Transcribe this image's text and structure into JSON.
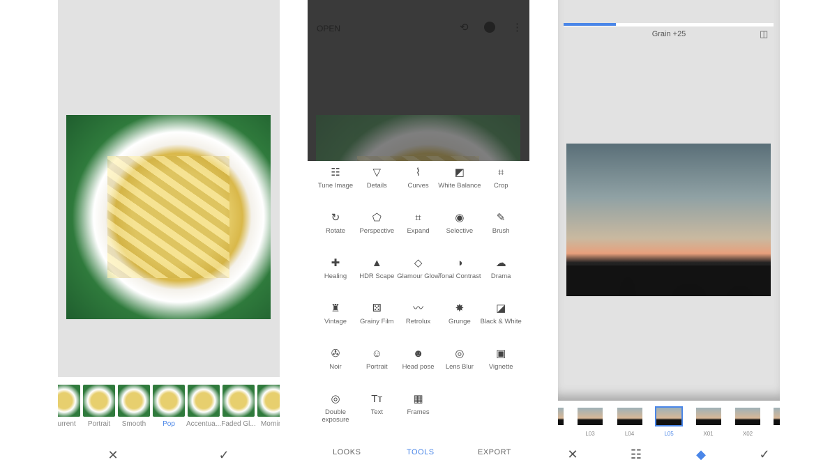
{
  "looks_panel": {
    "filters": [
      "Current",
      "Portrait",
      "Smooth",
      "Pop",
      "Accentua...",
      "Faded Gl...",
      "Morning"
    ],
    "selected": "Pop",
    "cancel_icon": "close-icon",
    "apply_icon": "check-icon"
  },
  "tools_panel": {
    "header": {
      "open_label": "OPEN",
      "icons": [
        "history-icon",
        "info-icon",
        "more-vert-icon"
      ]
    },
    "tools": [
      {
        "label": "Tune Image",
        "icon": "☷"
      },
      {
        "label": "Details",
        "icon": "▽"
      },
      {
        "label": "Curves",
        "icon": "⌇"
      },
      {
        "label": "White Balance",
        "icon": "◩"
      },
      {
        "label": "Crop",
        "icon": "⌗"
      },
      {
        "label": "Rotate",
        "icon": "↻"
      },
      {
        "label": "Perspective",
        "icon": "⬠"
      },
      {
        "label": "Expand",
        "icon": "⌗"
      },
      {
        "label": "Selective",
        "icon": "◉"
      },
      {
        "label": "Brush",
        "icon": "✎"
      },
      {
        "label": "Healing",
        "icon": "✚"
      },
      {
        "label": "HDR Scape",
        "icon": "▲"
      },
      {
        "label": "Glamour Glow",
        "icon": "◇"
      },
      {
        "label": "Tonal Contrast",
        "icon": "◑"
      },
      {
        "label": "Drama",
        "icon": "☁"
      },
      {
        "label": "Vintage",
        "icon": "♜"
      },
      {
        "label": "Grainy Film",
        "icon": "⚄"
      },
      {
        "label": "Retrolux",
        "icon": "〰"
      },
      {
        "label": "Grunge",
        "icon": "✸"
      },
      {
        "label": "Black & White",
        "icon": "◪"
      },
      {
        "label": "Noir",
        "icon": "✇"
      },
      {
        "label": "Portrait",
        "icon": "☺"
      },
      {
        "label": "Head pose",
        "icon": "☻"
      },
      {
        "label": "Lens Blur",
        "icon": "◎"
      },
      {
        "label": "Vignette",
        "icon": "▣"
      },
      {
        "label": "Double exposure",
        "icon": "◎"
      },
      {
        "label": "Text",
        "icon": "Tт"
      },
      {
        "label": "Frames",
        "icon": "▦"
      }
    ],
    "tabs": [
      "LOOKS",
      "TOOLS",
      "EXPORT"
    ],
    "active_tab": "TOOLS"
  },
  "grainy_panel": {
    "slider_label": "Grain +25",
    "slider_value": 25,
    "slider_max": 100,
    "styles": [
      "L03",
      "L04",
      "L05",
      "X01",
      "X02"
    ],
    "selected_style": "L05",
    "bottom_icons": [
      "close-icon",
      "tune-icon",
      "style-icon",
      "check-icon"
    ]
  },
  "colors": {
    "accent": "#4a86e8",
    "panel_gray": "#e2e2e2",
    "overlay": "#3a3a3a"
  }
}
